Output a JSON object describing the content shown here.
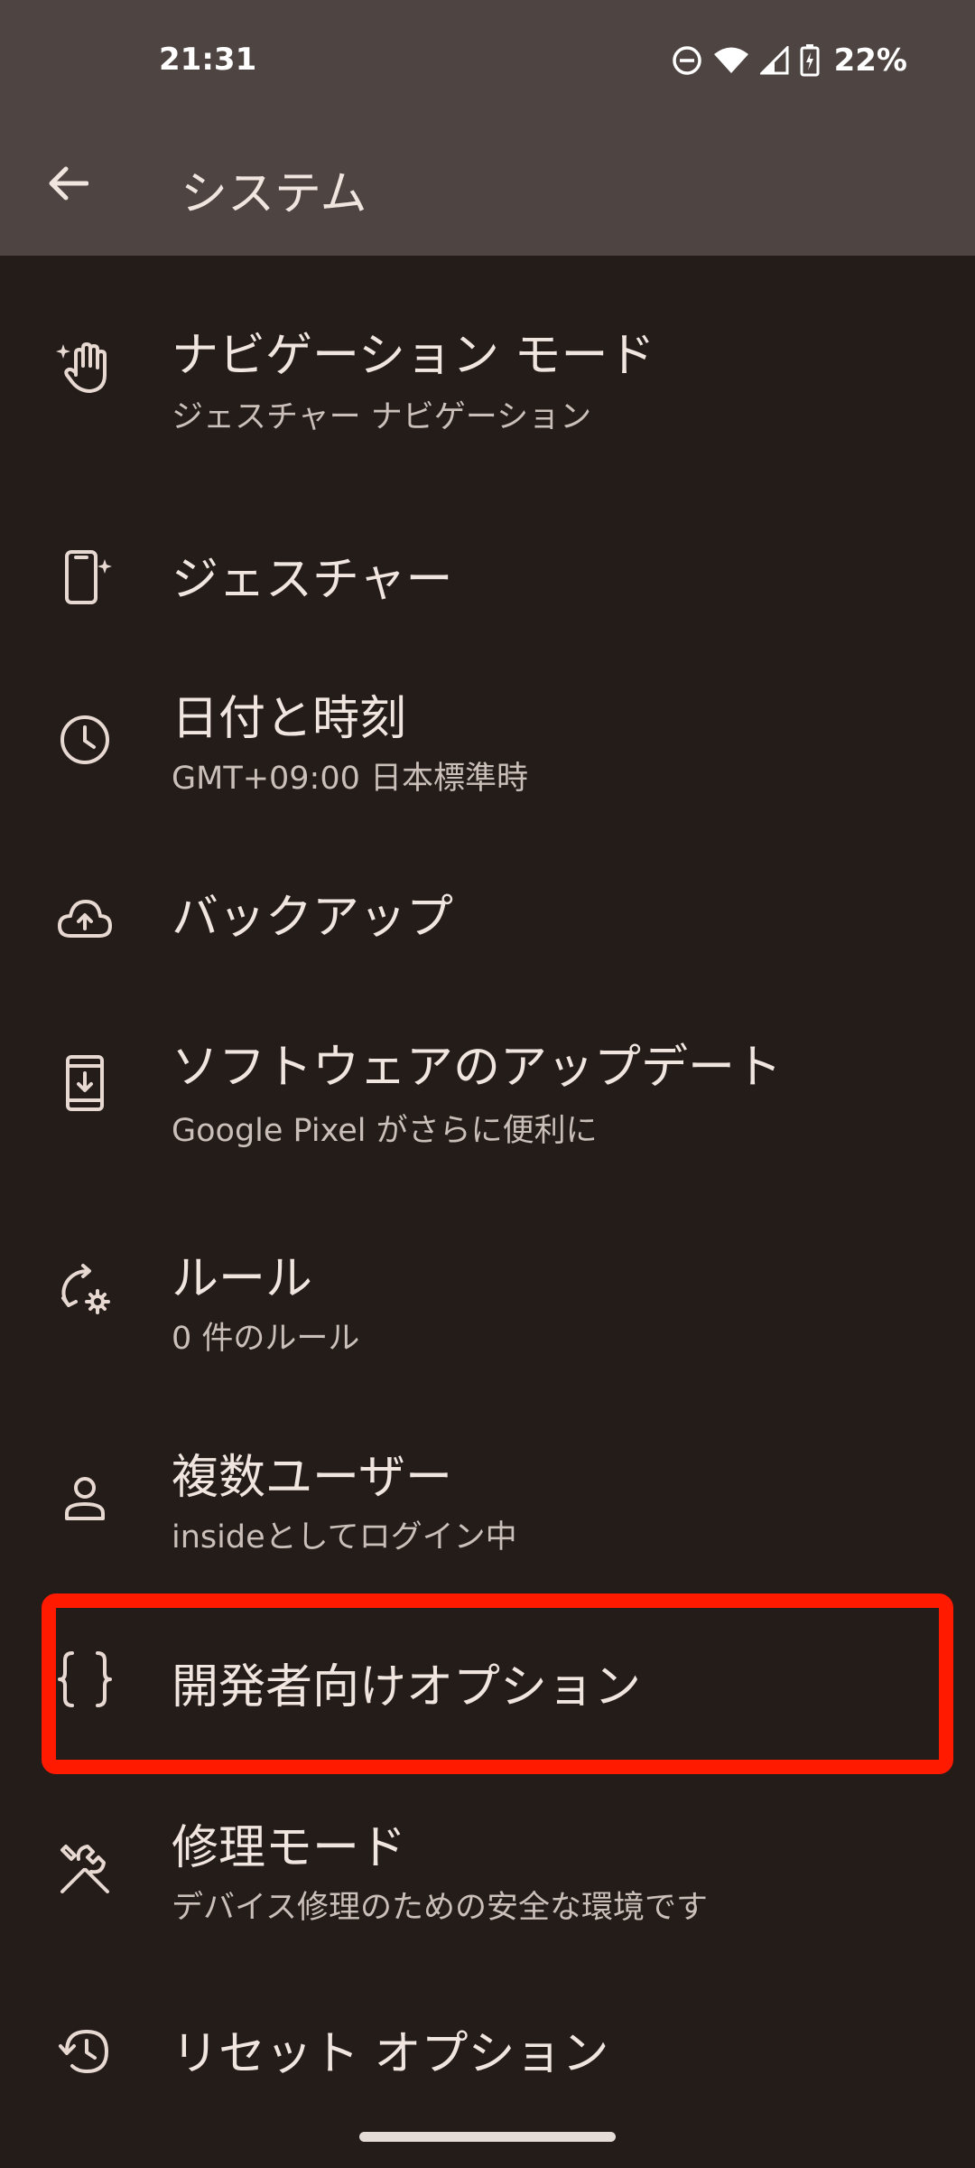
{
  "status_bar": {
    "time": "21:31",
    "battery": "22%",
    "icons": [
      "do-not-disturb-icon",
      "wifi-icon",
      "signal-icon",
      "battery-charging-icon"
    ]
  },
  "header": {
    "title": "システム",
    "back_icon": "arrow-back-icon"
  },
  "items": [
    {
      "title": "ナビゲーション モード",
      "subtitle": "ジェスチャー ナビゲーション",
      "icon": "gesture-hand-icon"
    },
    {
      "title": "ジェスチャー",
      "subtitle": "",
      "icon": "phone-gesture-icon"
    },
    {
      "title": "日付と時刻",
      "subtitle": "GMT+09:00 日本標準時",
      "icon": "clock-icon"
    },
    {
      "title": "バックアップ",
      "subtitle": "",
      "icon": "cloud-upload-icon"
    },
    {
      "title": "ソフトウェアのアップデート",
      "subtitle": "Google Pixel がさらに便利に",
      "icon": "system-update-icon"
    },
    {
      "title": "ルール",
      "subtitle": "0 件のルール",
      "icon": "rules-sync-gear-icon"
    },
    {
      "title": "複数ユーザー",
      "subtitle": "insideとしてログイン中",
      "icon": "person-icon"
    },
    {
      "title": "開発者向けオプション",
      "subtitle": "",
      "icon": "code-braces-icon"
    },
    {
      "title": "修理モード",
      "subtitle": "デバイス修理のための安全な環境です",
      "icon": "repair-tools-icon"
    },
    {
      "title": "リセット オプション",
      "subtitle": "",
      "icon": "history-reset-icon"
    }
  ],
  "colors": {
    "background": "#231c19",
    "header_background": "#4e4542",
    "highlight": "#ff1a00"
  }
}
